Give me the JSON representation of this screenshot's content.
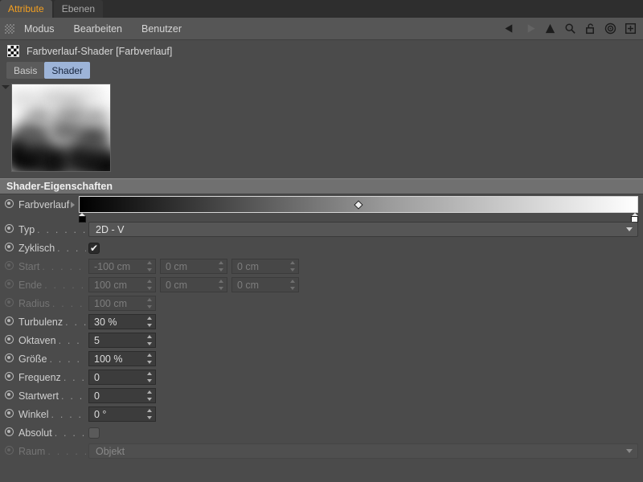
{
  "window_tabs": [
    {
      "label": "Attribute",
      "active": true,
      "color": "#f4a020"
    },
    {
      "label": "Ebenen",
      "active": false
    }
  ],
  "menubar": {
    "grip_icon": "grip-dots-icon",
    "items": [
      "Modus",
      "Bearbeiten",
      "Benutzer"
    ],
    "tools": [
      "back-arrow-icon",
      "forward-arrow-ghost-icon",
      "up-arrow-icon",
      "search-icon",
      "lock-open-icon",
      "target-icon",
      "plus-box-icon"
    ]
  },
  "object": {
    "icon": "checkerboard-shader-icon",
    "title": "Farbverlauf-Shader [Farbverlauf]",
    "tabs": [
      {
        "label": "Basis",
        "selected": false
      },
      {
        "label": "Shader",
        "selected": true
      }
    ]
  },
  "preview": {
    "collapse_icon": "triangle-down-icon",
    "image_name": "gradient-turbulence-preview"
  },
  "section": {
    "title": "Shader-Eigenschaften"
  },
  "gradient": {
    "label": "Farbverlauf",
    "expand_icon": "triangle-right-icon",
    "start_color": "#000000",
    "end_color": "#ffffff",
    "mid_marker_position": "50%",
    "knots": [
      {
        "position": "0%",
        "color": "#000000"
      },
      {
        "position": "100%",
        "color": "#ffffff"
      }
    ]
  },
  "fields": {
    "typ": {
      "label": "Typ",
      "dots": ". . . . . . . . .",
      "value": "2D - V",
      "enabled": true,
      "caret_icon": "chevron-down-icon"
    },
    "zyklisch": {
      "label": "Zyklisch",
      "dots": ". . . . .",
      "checked": true,
      "check_icon": "check-icon",
      "enabled": true
    },
    "start": {
      "label": "Start",
      "dots": ". . . . . . . .",
      "enabled": false,
      "values": [
        "-100 cm",
        "0 cm",
        "0 cm"
      ]
    },
    "ende": {
      "label": "Ende",
      "dots": ". . . . . . . .",
      "enabled": false,
      "values": [
        "100 cm",
        "0 cm",
        "0 cm"
      ]
    },
    "radius": {
      "label": "Radius",
      "dots": ". . . . . . .",
      "enabled": false,
      "values": [
        "100 cm"
      ]
    },
    "turbulenz": {
      "label": "Turbulenz",
      "dots": ". . . .",
      "enabled": true,
      "values": [
        "30 %"
      ]
    },
    "oktaven": {
      "label": "Oktaven",
      "dots": ". . . . .",
      "enabled": true,
      "values": [
        "5"
      ]
    },
    "groesse": {
      "label": "Größe",
      "dots": ". . . . . . .",
      "enabled": true,
      "values": [
        "100 %"
      ]
    },
    "frequenz": {
      "label": "Frequenz",
      "dots": ". . . .",
      "enabled": true,
      "values": [
        "0"
      ]
    },
    "startwert": {
      "label": "Startwert",
      "dots": ". . . .",
      "enabled": true,
      "values": [
        "0"
      ]
    },
    "winkel": {
      "label": "Winkel",
      "dots": ". . . . . . .",
      "enabled": true,
      "values": [
        "0 °"
      ]
    },
    "absolut": {
      "label": "Absolut",
      "dots": ". . . . . .",
      "checked": false,
      "enabled": true
    },
    "raum": {
      "label": "Raum",
      "dots": ". . . . . . . .",
      "value": "Objekt",
      "enabled": false,
      "caret_icon": "chevron-down-icon"
    }
  },
  "colors": {
    "panel_bg": "#4b4b4b",
    "menubar_bg": "#565656",
    "tabstrip_bg": "#2e2e2e",
    "accent_tab_text": "#f4a020",
    "selected_tab_bg": "#9db4d8",
    "section_header_bg": "#707070",
    "field_bg": "#3c3c3c",
    "label_text": "#cfcfcf",
    "disabled_text": "#7d7d7d"
  }
}
